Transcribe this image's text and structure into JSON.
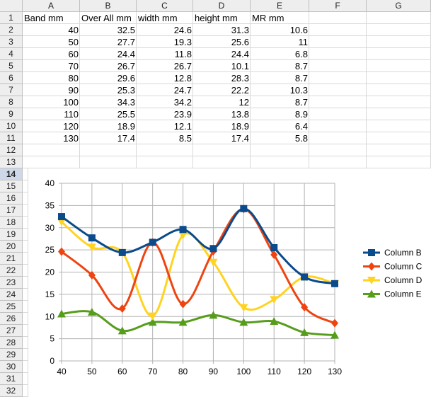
{
  "columns": [
    "A",
    "B",
    "C",
    "D",
    "E",
    "F",
    "G"
  ],
  "rows": [
    "1",
    "2",
    "3",
    "4",
    "5",
    "6",
    "7",
    "8",
    "9",
    "10",
    "11",
    "12",
    "13",
    "14",
    "15",
    "16",
    "17",
    "18",
    "19",
    "20",
    "21",
    "22",
    "23",
    "24",
    "25",
    "26",
    "27",
    "28",
    "29",
    "30",
    "31",
    "32"
  ],
  "active_row": "14",
  "table": {
    "headers": [
      "Band mm",
      "Over All mm",
      "width mm",
      "height mm",
      "MR mm"
    ],
    "rows": [
      [
        "40",
        "32.5",
        "24.6",
        "31.3",
        "10.6"
      ],
      [
        "50",
        "27.7",
        "19.3",
        "25.6",
        "11"
      ],
      [
        "60",
        "24.4",
        "11.8",
        "24.4",
        "6.8"
      ],
      [
        "70",
        "26.7",
        "26.7",
        "10.1",
        "8.7"
      ],
      [
        "80",
        "29.6",
        "12.8",
        "28.3",
        "8.7"
      ],
      [
        "90",
        "25.3",
        "24.7",
        "22.2",
        "10.3"
      ],
      [
        "100",
        "34.3",
        "34.2",
        "12",
        "8.7"
      ],
      [
        "110",
        "25.5",
        "23.9",
        "13.8",
        "8.9"
      ],
      [
        "120",
        "18.9",
        "12.1",
        "18.9",
        "6.4"
      ],
      [
        "130",
        "17.4",
        "8.5",
        "17.4",
        "5.8"
      ]
    ]
  },
  "chart_data": {
    "type": "line",
    "x": [
      40,
      50,
      60,
      70,
      80,
      90,
      100,
      110,
      120,
      130
    ],
    "ylim": [
      0,
      40
    ],
    "yticks": [
      "0",
      "5",
      "10",
      "15",
      "20",
      "25",
      "30",
      "35",
      "40"
    ],
    "xticks": [
      "40",
      "50",
      "60",
      "70",
      "80",
      "90",
      "100",
      "110",
      "120",
      "130"
    ],
    "grid": true,
    "smooth": true,
    "legend_position": "right",
    "series": [
      {
        "name": "Column B",
        "values": [
          32.5,
          27.7,
          24.4,
          26.7,
          29.6,
          25.3,
          34.3,
          25.5,
          18.9,
          17.4
        ],
        "color": "#0b4a8b",
        "marker": "square"
      },
      {
        "name": "Column C",
        "values": [
          24.6,
          19.3,
          11.8,
          26.7,
          12.8,
          24.7,
          34.2,
          23.9,
          12.1,
          8.5
        ],
        "color": "#ee4411",
        "marker": "diamond"
      },
      {
        "name": "Column D",
        "values": [
          31.3,
          25.6,
          24.4,
          10.1,
          28.3,
          22.2,
          12,
          13.8,
          18.9,
          17.4
        ],
        "color": "#ffd320",
        "marker": "triangle-down"
      },
      {
        "name": "Column E",
        "values": [
          10.6,
          11,
          6.8,
          8.7,
          8.7,
          10.3,
          8.7,
          8.9,
          6.4,
          5.8
        ],
        "color": "#579d1c",
        "marker": "triangle-up"
      }
    ]
  }
}
